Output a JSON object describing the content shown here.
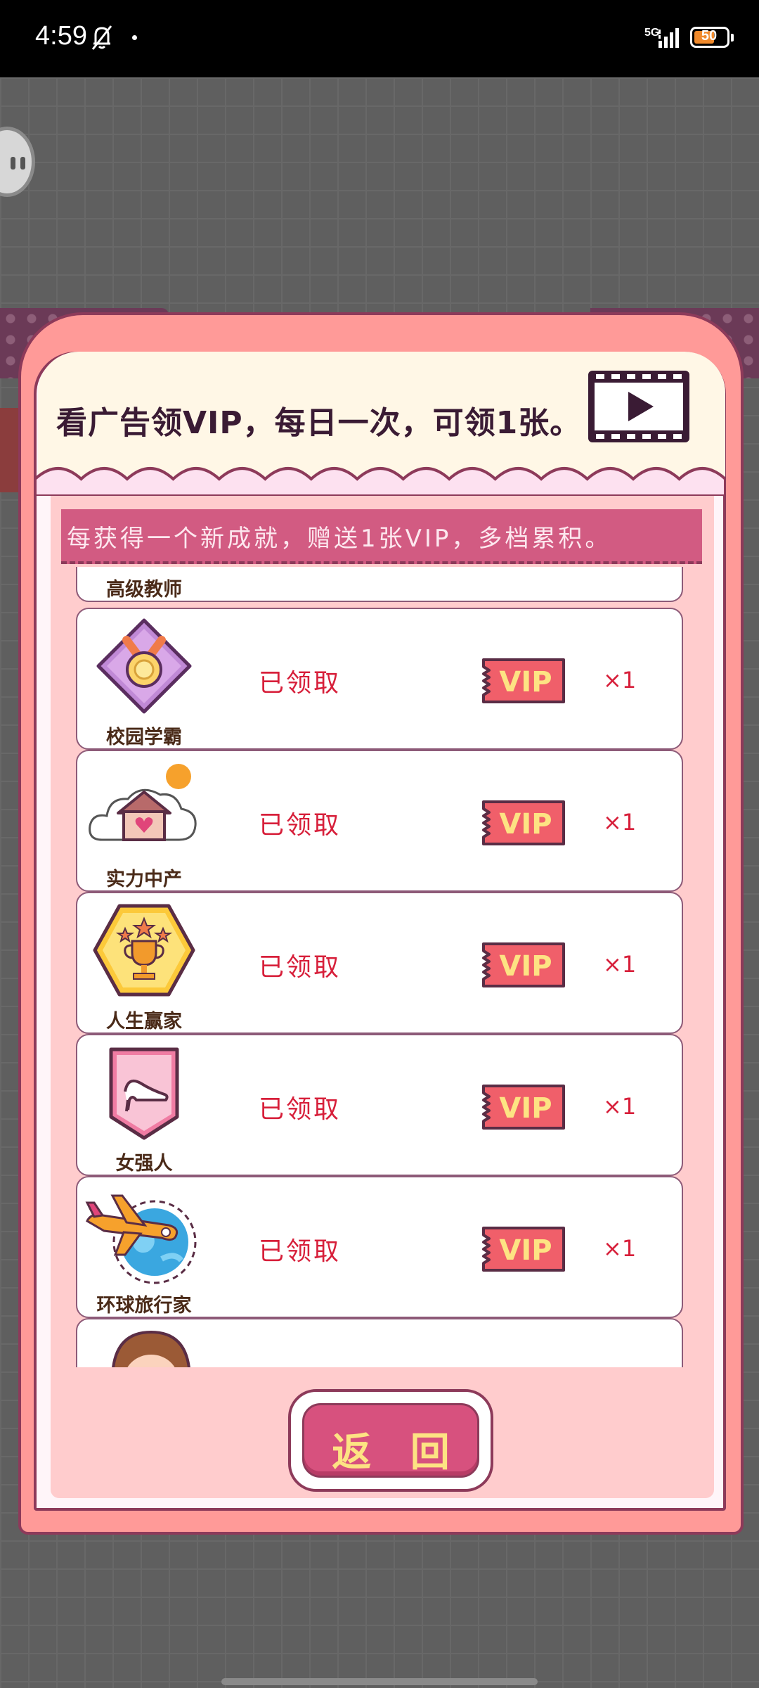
{
  "status_bar": {
    "time": "4:59",
    "network": "5G",
    "battery_level": "50",
    "icons": [
      "bell-off-icon",
      "notification-dot-icon",
      "signal-icon",
      "battery-icon"
    ]
  },
  "popup": {
    "ad_text": "看广告领VIP，每日一次，可领1张。",
    "ad_icon": "video-play-icon",
    "banner_text": "每获得一个新成就，赠送1张VIP，多档累积。",
    "rows": [
      {
        "name": "高级教师",
        "status": "",
        "vip": "",
        "qty": "",
        "icon": "teacher-icon"
      },
      {
        "name": "校园学霸",
        "status": "已领取",
        "vip": "VIP",
        "qty": "×1",
        "icon": "medal-icon"
      },
      {
        "name": "实力中产",
        "status": "已领取",
        "vip": "VIP",
        "qty": "×1",
        "icon": "house-icon"
      },
      {
        "name": "人生赢家",
        "status": "已领取",
        "vip": "VIP",
        "qty": "×1",
        "icon": "trophy-icon"
      },
      {
        "name": "女强人",
        "status": "已领取",
        "vip": "VIP",
        "qty": "×1",
        "icon": "high-heel-icon"
      },
      {
        "name": "环球旅行家",
        "status": "已领取",
        "vip": "VIP",
        "qty": "×1",
        "icon": "globe-plane-icon"
      },
      {
        "name": "",
        "status": "",
        "vip": "",
        "qty": "",
        "icon": "avatar-icon"
      }
    ],
    "return_label": "返 回"
  },
  "colors": {
    "panel": "#ff9a98",
    "outline": "#8d3a5a",
    "banner": "#d25b82",
    "status_red": "#d71f3a",
    "vip_ticket": "#f05f6a",
    "vip_text": "#fde383"
  }
}
